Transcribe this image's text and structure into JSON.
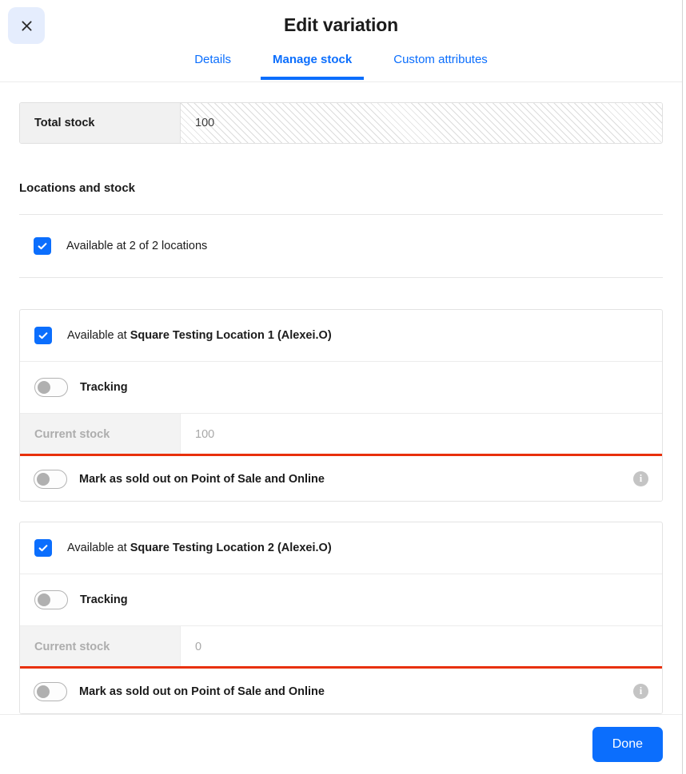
{
  "header": {
    "title": "Edit variation",
    "close_icon": "close-icon",
    "tabs": [
      {
        "label": "Details",
        "active": false
      },
      {
        "label": "Manage stock",
        "active": true
      },
      {
        "label": "Custom attributes",
        "active": false
      }
    ]
  },
  "total_stock": {
    "label": "Total stock",
    "value": "100"
  },
  "locations_section": {
    "heading": "Locations and stock",
    "master_checkbox_label": "Available at 2 of 2 locations",
    "checkbox_checked": true
  },
  "locations": [
    {
      "available_prefix": "Available at ",
      "name": "Square Testing Location 1 (Alexei.O)",
      "checkbox_checked": true,
      "tracking_label": "Tracking",
      "tracking_on": false,
      "current_stock_label": "Current stock",
      "current_stock_value": "100",
      "sold_out_label": "Mark as sold out on Point of Sale and Online",
      "sold_out_on": false,
      "info_icon": "info-icon",
      "highlighted": true
    },
    {
      "available_prefix": "Available at ",
      "name": "Square Testing Location 2 (Alexei.O)",
      "checkbox_checked": true,
      "tracking_label": "Tracking",
      "tracking_on": false,
      "current_stock_label": "Current stock",
      "current_stock_value": "0",
      "sold_out_label": "Mark as sold out on Point of Sale and Online",
      "sold_out_on": false,
      "info_icon": "info-icon",
      "highlighted": true
    }
  ],
  "footer": {
    "done_label": "Done"
  },
  "colors": {
    "accent": "#0b6efd",
    "highlight": "#e8300b",
    "close_bg": "#e5edfd",
    "disabled_text": "#a8a8a8"
  }
}
